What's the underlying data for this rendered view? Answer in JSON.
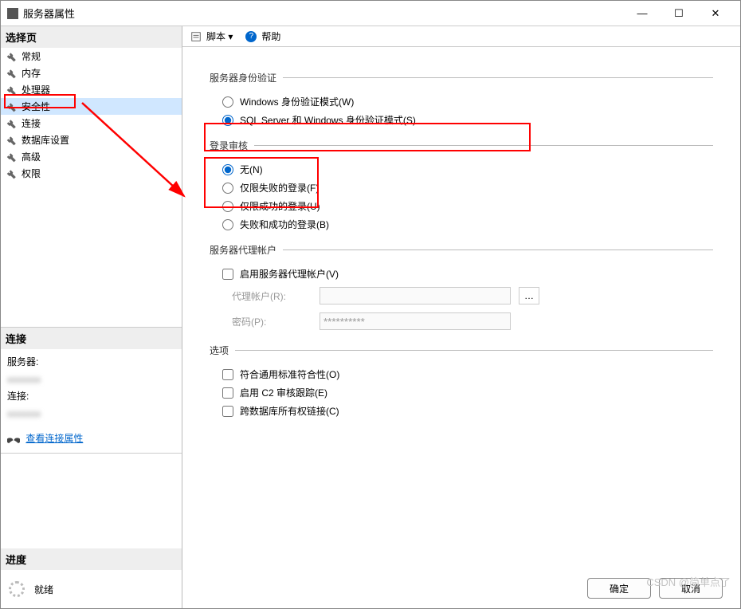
{
  "window": {
    "title": "服务器属性"
  },
  "titlebar_controls": {
    "min": "—",
    "max": "☐",
    "close": "✕"
  },
  "sidebar": {
    "header_pages": "选择页",
    "pages": [
      {
        "label": "常规"
      },
      {
        "label": "内存"
      },
      {
        "label": "处理器"
      },
      {
        "label": "安全性",
        "selected": true
      },
      {
        "label": "连接"
      },
      {
        "label": "数据库设置"
      },
      {
        "label": "高级"
      },
      {
        "label": "权限"
      }
    ],
    "header_conn": "连接",
    "conn_server_label": "服务器:",
    "conn_conn_label": "连接:",
    "view_conn_props": "查看连接属性",
    "header_progress": "进度",
    "progress_text": "就绪"
  },
  "toolbar": {
    "script": "脚本",
    "dropdown": "▾",
    "help_icon": "?",
    "help": "帮助"
  },
  "content": {
    "auth_section": "服务器身份验证",
    "auth_windows": "Windows 身份验证模式(W)",
    "auth_mixed": "SQL Server 和 Windows 身份验证模式(S)",
    "audit_section": "登录审核",
    "audit_none": "无(N)",
    "audit_fail": "仅限失败的登录(F)",
    "audit_succ": "仅限成功的登录(U)",
    "audit_both": "失败和成功的登录(B)",
    "proxy_section": "服务器代理帐户",
    "proxy_enable": "启用服务器代理帐户(V)",
    "proxy_account_label": "代理帐户(R):",
    "proxy_pwd_label": "密码(P):",
    "proxy_pwd_value": "**********",
    "options_section": "选项",
    "opt_compliance": "符合通用标准符合性(O)",
    "opt_c2": "启用 C2 审核跟踪(E)",
    "opt_cross": "跨数据库所有权链接(C)"
  },
  "footer": {
    "ok": "确定",
    "cancel": "取消"
  },
  "watermark": "CSDN @简单点了"
}
